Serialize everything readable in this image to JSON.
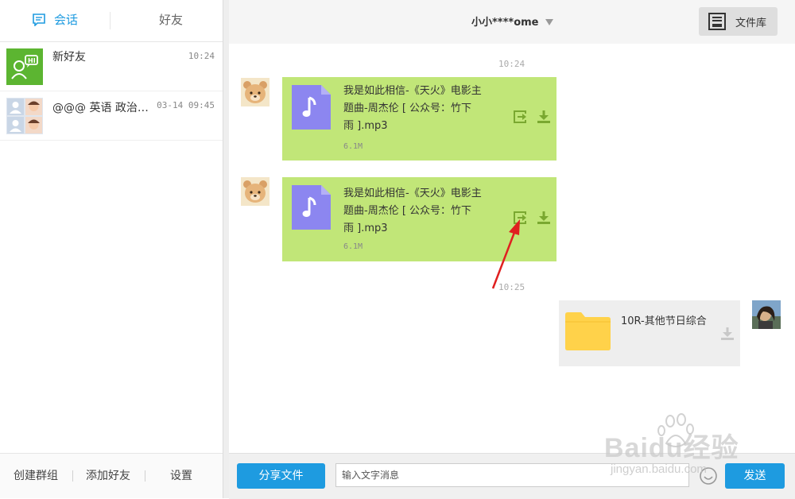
{
  "tabs": {
    "sessions": "会话",
    "friends": "好友"
  },
  "conversations": [
    {
      "name": "新好友",
      "time": "10:24",
      "avatar_icon": "hi-chat-icon"
    },
    {
      "name": "@@@ 英语 政治…",
      "time": "03-14 09:45",
      "avatar_icon": "group-avatar-icon"
    }
  ],
  "sidebar_bottom": {
    "create_group": "创建群组",
    "add_friend": "添加好友",
    "settings": "设置"
  },
  "header": {
    "contact": "小小****ome",
    "library": "文件库"
  },
  "messages": [
    {
      "timestamp": "10:24",
      "title_lines": [
        "我是如此相信-《天火》电影主",
        "题曲-周杰伦 [ 公众号：竹下",
        "雨 ].mp3"
      ],
      "size": "6.1M"
    },
    {
      "title_lines": [
        "我是如此相信-《天火》电影主",
        "题曲-周杰伦 [ 公众号：竹下",
        "雨 ].mp3"
      ],
      "size": "6.1M"
    },
    {
      "timestamp": "10:25",
      "folder_name": "10R-其他节日综合"
    }
  ],
  "input": {
    "share_button": "分享文件",
    "placeholder": "输入文字消息",
    "send_button": "发送"
  },
  "watermark": {
    "logo": "Baidu经验",
    "url": "jingyan.baidu.com"
  },
  "colors": {
    "accent": "#1e9be0",
    "bubble_green": "#c1e678",
    "action_green": "#7aa830",
    "music_icon": "#8c86f0",
    "folder": "#ffd24a",
    "annotation_arrow": "#e02020"
  }
}
